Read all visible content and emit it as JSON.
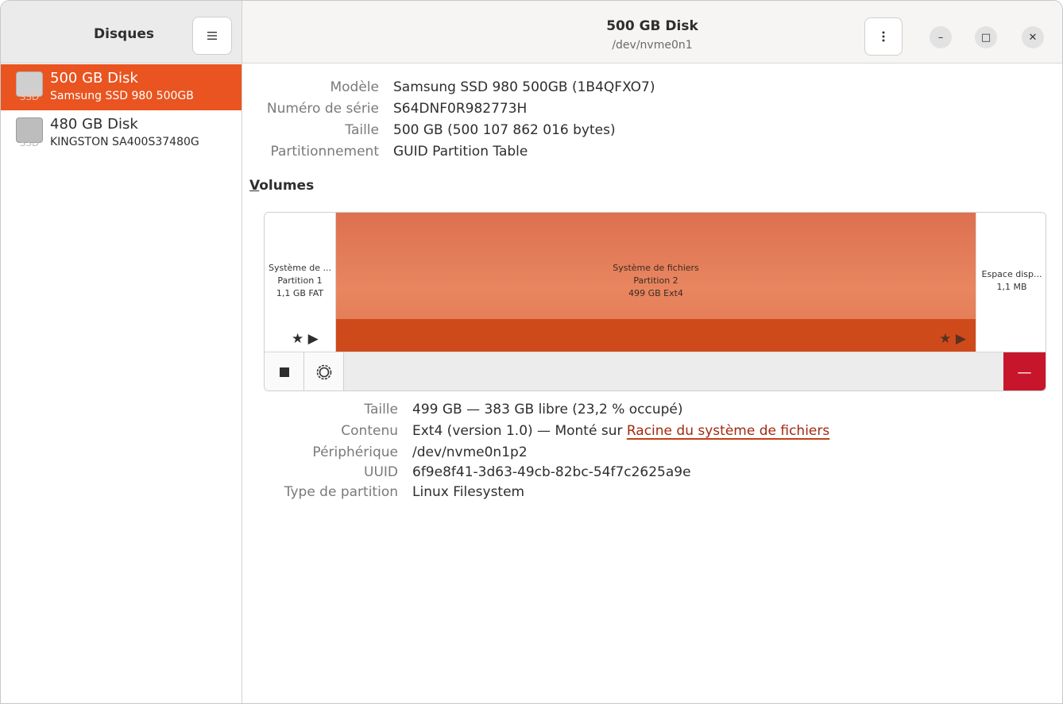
{
  "sidebar": {
    "title": "Disques",
    "disks": [
      {
        "name": "500 GB Disk",
        "model": "Samsung SSD 980 500GB",
        "icon_badge": "SSD",
        "selected": true
      },
      {
        "name": "480 GB Disk",
        "model": "KINGSTON SA400S37480G",
        "icon_badge": "SSD",
        "selected": false
      }
    ]
  },
  "header": {
    "title": "500 GB Disk",
    "subtitle": "/dev/nvme0n1"
  },
  "window_controls": {
    "minimize": "–",
    "maximize": "□",
    "close": "✕"
  },
  "disk_info": [
    {
      "label": "Modèle",
      "value": "Samsung SSD 980 500GB (1B4QFXO7)"
    },
    {
      "label": "Numéro de série",
      "value": "S64DNF0R982773H"
    },
    {
      "label": "Taille",
      "value": "500 GB (500 107 862 016 bytes)"
    },
    {
      "label": "Partitionnement",
      "value": "GUID Partition Table"
    }
  ],
  "volumes": {
    "heading_accel": "V",
    "heading_rest": "olumes",
    "segments": [
      {
        "line1": "Système de ...",
        "line2": "Partition 1",
        "line3": "1,1 GB FAT"
      },
      {
        "line1": "Système de fichiers",
        "line2": "Partition 2",
        "line3": "499 GB Ext4",
        "selected": true
      },
      {
        "line1": "Espace disp...",
        "line2": "1,1 MB"
      }
    ]
  },
  "volume_info": {
    "size_label": "Taille",
    "size_value": "499 GB — 383 GB libre (23,2 % occupé)",
    "content_label": "Contenu",
    "content_value": "Ext4 (version 1.0) — Monté sur ",
    "content_link": "Racine du système de fichiers",
    "device_label": "Périphérique",
    "device_value": "/dev/nvme0n1p2",
    "uuid_label": "UUID",
    "uuid_value": "6f9e8f41-3d63-49cb-82bc-54f7c2625a9e",
    "ptype_label": "Type de partition",
    "ptype_value": "Linux Filesystem"
  },
  "colors": {
    "accent": "#e95420",
    "partition_selected": "#cf4a1b",
    "delete": "#c7162b"
  }
}
